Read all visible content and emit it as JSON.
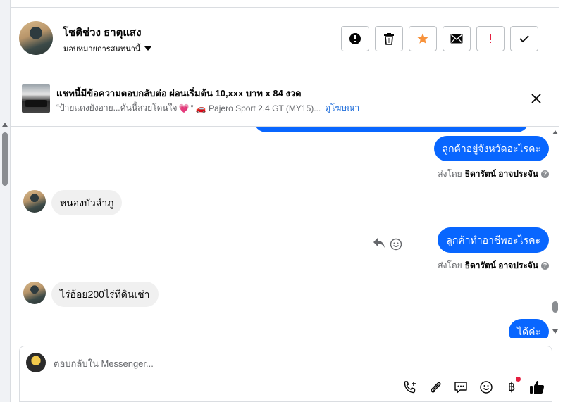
{
  "header": {
    "contact_name": "โชติช่วง ธาตุแสง",
    "assign_label": "มอบหมายการสนทนานี้",
    "actions": [
      {
        "name": "report-button",
        "icon": "alert-circle-icon"
      },
      {
        "name": "delete-button",
        "icon": "trash-icon"
      },
      {
        "name": "star-button",
        "icon": "star-icon"
      },
      {
        "name": "mark-unread-button",
        "icon": "envelope-icon"
      },
      {
        "name": "follow-up-button",
        "icon": "exclamation-icon"
      },
      {
        "name": "mark-done-button",
        "icon": "check-icon"
      }
    ]
  },
  "ad": {
    "title": "แชทนี้มีข้อความตอบกลับต่อ ผ่อนเริ่มต้น 10,xxx บาท x 84 งวด",
    "subtitle_pre": "“ป้ายแดงยังอาย...คันนี้สวยโดนใจ",
    "heart": "💗",
    "subtitle_post": "” 🚗 Pajero Sport 2.4 GT (MY15)...",
    "link": "ดูโฆษณา"
  },
  "messages": {
    "out1": "ลูกค้าอยู่จังหวัดอะไรคะ",
    "sent_by_label": "ส่งโดย",
    "sent_by_name": "ธิดารัตน์ อาจประจัน",
    "in1": "หนองบัวลำภู",
    "out2": "ลูกค้าทำอาชีพอะไรคะ",
    "in2": "ไร่อ้อย200ไร่ทีดินเช่า",
    "out3": "ได้ค่ะ"
  },
  "composer": {
    "placeholder": "ตอบกลับใน Messenger...",
    "baht_symbol": "฿"
  },
  "colors": {
    "accent": "#0866ff",
    "star": "#f7923b",
    "exclaim": "#e41e3f"
  }
}
